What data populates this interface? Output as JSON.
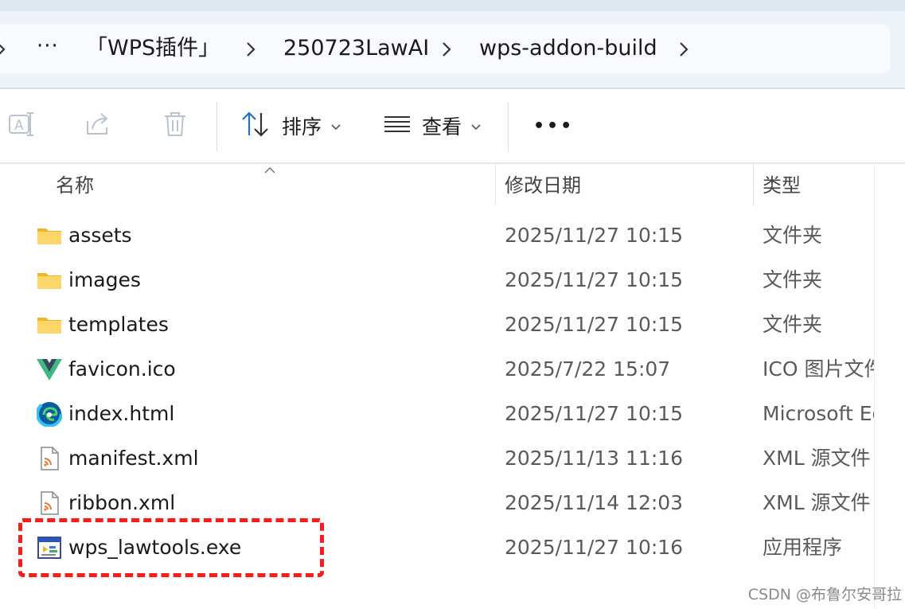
{
  "breadcrumb": {
    "overflow": "···",
    "items": [
      "「WPS插件」",
      "250723LawAI",
      "wps-addon-build"
    ]
  },
  "toolbar": {
    "sort_label": "排序",
    "view_label": "查看",
    "more_label": "•••"
  },
  "columns": {
    "name": "名称",
    "modified": "修改日期",
    "type": "类型"
  },
  "files": [
    {
      "name": "assets",
      "date": "2025/11/27 10:15",
      "type": "文件夹",
      "icon": "folder-icon"
    },
    {
      "name": "images",
      "date": "2025/11/27 10:15",
      "type": "文件夹",
      "icon": "folder-icon"
    },
    {
      "name": "templates",
      "date": "2025/11/27 10:15",
      "type": "文件夹",
      "icon": "folder-icon"
    },
    {
      "name": "favicon.ico",
      "date": "2025/7/22 15:07",
      "type": "ICO 图片文件",
      "icon": "vue-logo-icon"
    },
    {
      "name": "index.html",
      "date": "2025/11/27 10:15",
      "type": "Microsoft Edge",
      "icon": "edge-icon"
    },
    {
      "name": "manifest.xml",
      "date": "2025/11/13 11:16",
      "type": "XML 源文件",
      "icon": "xml-file-icon"
    },
    {
      "name": "ribbon.xml",
      "date": "2025/11/14 12:03",
      "type": "XML 源文件",
      "icon": "xml-file-icon"
    },
    {
      "name": "wps_lawtools.exe",
      "date": "2025/11/27 10:16",
      "type": "应用程序",
      "icon": "exe-app-icon"
    }
  ],
  "watermark": "CSDN @布鲁尔安哥拉",
  "colors": {
    "highlight": "#ff1a1a",
    "folder": "#f7c948",
    "accent": "#1a73c8"
  }
}
